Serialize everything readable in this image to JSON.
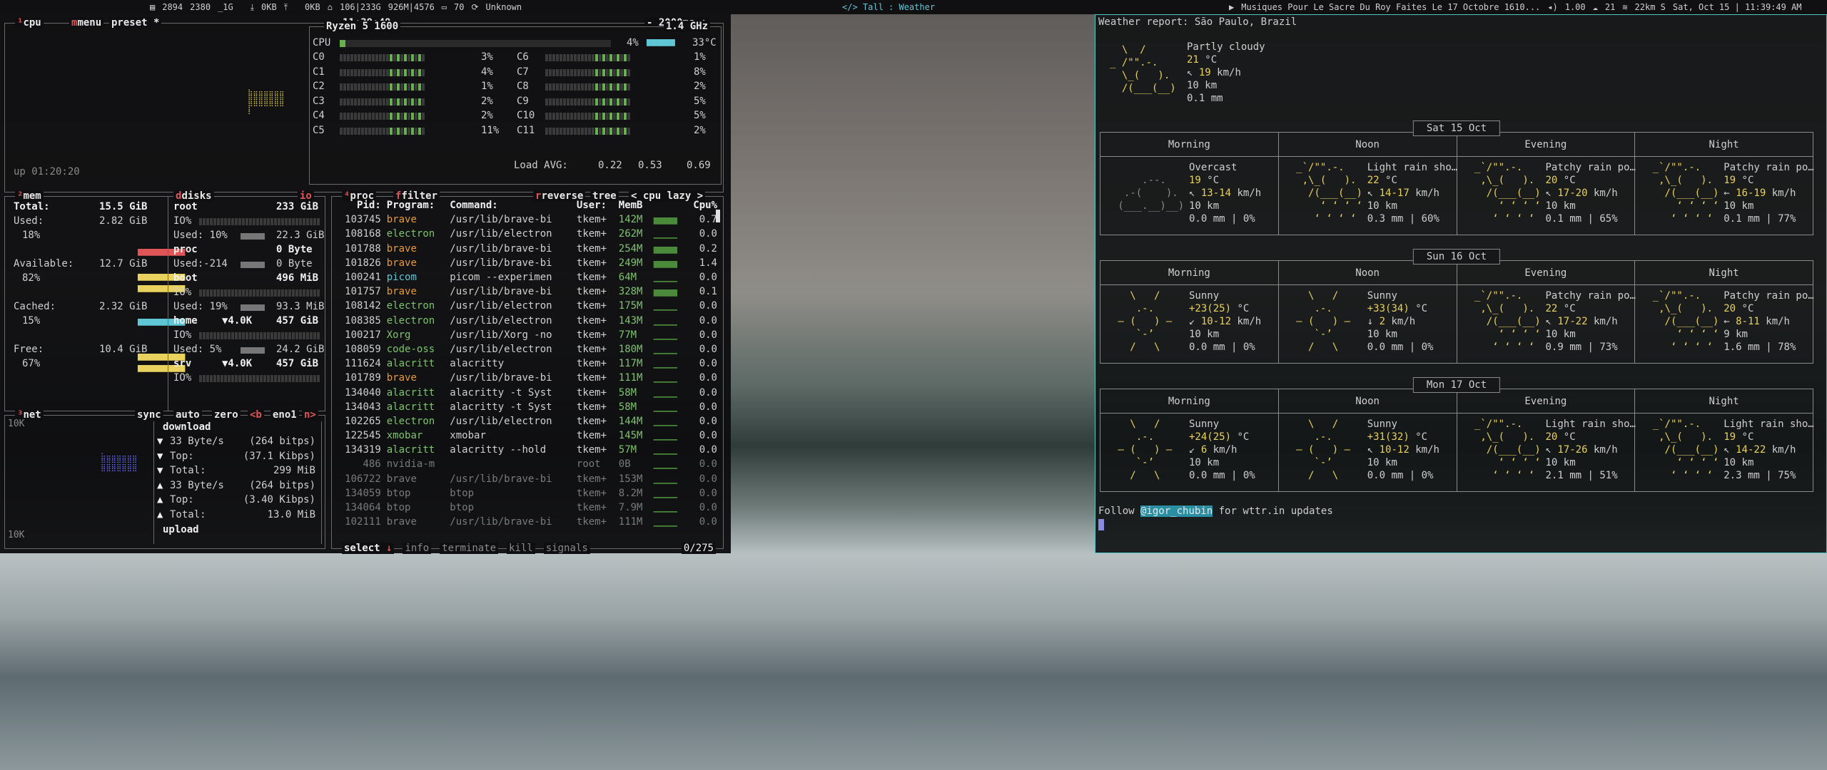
{
  "topbar": {
    "left": [
      "2894",
      "2380",
      "_1G",
      "0KB",
      "0KB",
      "106|233G",
      "926M|4576",
      "70",
      "Unknown"
    ],
    "center": "</>  Tall : Weather",
    "right": [
      "Musiques Pour Le Sacre Du Roy Faites Le 17 Octobre 1610...",
      "1.00",
      "21",
      "22km S",
      "Sat, Oct 15 | 11:39:49 AM"
    ]
  },
  "cpu": {
    "title": "cpu",
    "menu": "menu",
    "preset": "preset *",
    "time": "11:39:48",
    "interval": "- 2000ms +",
    "model": "Ryzen 5 1600",
    "freq": "1.4 GHz",
    "total_pct": "4%",
    "temp": "33°C",
    "uptime": "up 01:20:20",
    "cores": [
      {
        "n": "C0",
        "p": "3%",
        "n2": "C6",
        "p2": "1%"
      },
      {
        "n": "C1",
        "p": "4%",
        "n2": "C7",
        "p2": "8%"
      },
      {
        "n": "C2",
        "p": "1%",
        "n2": "C8",
        "p2": "2%"
      },
      {
        "n": "C3",
        "p": "2%",
        "n2": "C9",
        "p2": "5%"
      },
      {
        "n": "C4",
        "p": "2%",
        "n2": "C10",
        "p2": "5%"
      },
      {
        "n": "C5",
        "p": "11%",
        "n2": "C11",
        "p2": "2%"
      }
    ],
    "load_label": "Load AVG:",
    "load": [
      "0.22",
      "0.53",
      "0.69"
    ]
  },
  "mem": {
    "title": "mem",
    "total_label": "Total:",
    "total": "15.5 GiB",
    "used_label": "Used:",
    "used": "2.82 GiB",
    "used_pct": "18%",
    "avail_label": "Available:",
    "avail": "12.7 GiB",
    "avail_pct": "82%",
    "cached_label": "Cached:",
    "cached": "2.32 GiB",
    "cached_pct": "15%",
    "free_label": "Free:",
    "free": "10.4 GiB",
    "free_pct": "67%"
  },
  "disks": {
    "title": "disks",
    "io": "io",
    "items": [
      {
        "name": "root",
        "size": "233 GiB",
        "io": "IO%",
        "used": "Used: 10%",
        "uval": "22.3 GiB"
      },
      {
        "name": "proc",
        "size": "0 Byte",
        "io": "",
        "used": "Used:-214",
        "uval": "0 Byte"
      },
      {
        "name": "boot",
        "size": "496 MiB",
        "io": "IO%",
        "used": "Used: 19%",
        "uval": "93.3 MiB"
      },
      {
        "name": "home",
        "size": "457 GiB",
        "io": "IO%",
        "used": "Used:  5%",
        "uval": "24.2 GiB",
        "rate": "▼4.0K"
      },
      {
        "name": "srv",
        "size": "457 GiB",
        "io": "IO%",
        "used": "",
        "uval": "",
        "rate": "▼4.0K"
      }
    ]
  },
  "net": {
    "title": "net",
    "sync": "sync",
    "auto": "auto",
    "zero": "zero",
    "b": "<b",
    "iface": "eno1",
    "n": "n>",
    "scale_top": "10K",
    "scale_bot": "10K",
    "download": "download",
    "upload": "upload",
    "rows": [
      {
        "a": "▼",
        "k": "33 Byte/s",
        "v": "(264 bitps)"
      },
      {
        "a": "▼",
        "k": "Top:",
        "v": "(37.1 Kibps)"
      },
      {
        "a": "▼",
        "k": "Total:",
        "v": "299 MiB"
      },
      {
        "a": "▲",
        "k": "33 Byte/s",
        "v": "(264 bitps)"
      },
      {
        "a": "▲",
        "k": "Top:",
        "v": "(3.40 Kibps)"
      },
      {
        "a": "▲",
        "k": "Total:",
        "v": "13.0 MiB"
      }
    ]
  },
  "proc": {
    "title": "proc",
    "filter": "filter",
    "reverse": "reverse",
    "tree": "tree",
    "sort": "< cpu lazy >",
    "headers": [
      "Pid:",
      "Program:",
      "Command:",
      "User:",
      "MemB",
      "Cpu%"
    ],
    "rows": [
      [
        "103745",
        "brave",
        "/usr/lib/brave-bi",
        "tkem+",
        "142M",
        "0.7"
      ],
      [
        "108168",
        "electron",
        "/usr/lib/electron",
        "tkem+",
        "262M",
        "0.0"
      ],
      [
        "101788",
        "brave",
        "/usr/lib/brave-bi",
        "tkem+",
        "254M",
        "0.2"
      ],
      [
        "101826",
        "brave",
        "/usr/lib/brave-bi",
        "tkem+",
        "249M",
        "1.4"
      ],
      [
        "100241",
        "picom",
        "picom --experimen",
        "tkem+",
        "64M",
        "0.0"
      ],
      [
        "101757",
        "brave",
        "/usr/lib/brave-bi",
        "tkem+",
        "328M",
        "0.1"
      ],
      [
        "108142",
        "electron",
        "/usr/lib/electron",
        "tkem+",
        "175M",
        "0.0"
      ],
      [
        "108385",
        "electron",
        "/usr/lib/electron",
        "tkem+",
        "143M",
        "0.0"
      ],
      [
        "100217",
        "Xorg",
        "/usr/lib/Xorg -no",
        "tkem+",
        "77M",
        "0.0"
      ],
      [
        "108059",
        "code-oss",
        "/usr/lib/electron",
        "tkem+",
        "180M",
        "0.0"
      ],
      [
        "111624",
        "alacritt",
        "alacritty",
        "tkem+",
        "117M",
        "0.0"
      ],
      [
        "101789",
        "brave",
        "/usr/lib/brave-bi",
        "tkem+",
        "111M",
        "0.0"
      ],
      [
        "134040",
        "alacritt",
        "alacritty -t Syst",
        "tkem+",
        "58M",
        "0.0"
      ],
      [
        "134043",
        "alacritt",
        "alacritty -t Syst",
        "tkem+",
        "58M",
        "0.0"
      ],
      [
        "102265",
        "electron",
        "/usr/lib/electron",
        "tkem+",
        "144M",
        "0.0"
      ],
      [
        "122545",
        "xmobar",
        "xmobar",
        "tkem+",
        "145M",
        "0.0"
      ],
      [
        "134319",
        "alacritt",
        "alacritty --hold",
        "tkem+",
        "57M",
        "0.0"
      ],
      [
        "486",
        "nvidia-m",
        "",
        "root",
        "0B",
        "0.0"
      ],
      [
        "106722",
        "brave",
        "/usr/lib/brave-bi",
        "tkem+",
        "153M",
        "0.0"
      ],
      [
        "134059",
        "btop",
        "btop",
        "tkem+",
        "8.2M",
        "0.0"
      ],
      [
        "134064",
        "btop",
        "btop",
        "tkem+",
        "7.9M",
        "0.0"
      ],
      [
        "102111",
        "brave",
        "/usr/lib/brave-bi",
        "tkem+",
        "111M",
        "0.0"
      ]
    ],
    "footer": {
      "select": "select",
      "info": "info",
      "terminate": "terminate",
      "kill": "kill",
      "signals": "signals",
      "count": "0/275"
    }
  },
  "weather": {
    "header": "Weather report: São Paulo, Brazil",
    "now": {
      "cond": "Partly cloudy",
      "temp": "21",
      "tunit": " °C",
      "wind_dir": "↖",
      "wind": "19",
      "wunit": " km/h",
      "vis": "10 km",
      "precip": "0.1 mm"
    },
    "parts": [
      "Morning",
      "Noon",
      "Evening",
      "Night"
    ],
    "days": [
      {
        "label": "Sat 15 Oct",
        "slots": [
          {
            "cond": "Overcast",
            "t": "19",
            "wd": "↖",
            "w": "13-14",
            "vis": "10 km",
            "pr": "0.0 mm | 0%"
          },
          {
            "cond": "Light rain sho…",
            "t": "22",
            "wd": "↖",
            "w": "14-17",
            "vis": "10 km",
            "pr": "0.3 mm | 60%"
          },
          {
            "cond": "Patchy rain po…",
            "t": "20",
            "wd": "↖",
            "w": "17-20",
            "vis": "10 km",
            "pr": "0.1 mm | 65%"
          },
          {
            "cond": "Patchy rain po…",
            "t": "19",
            "wd": "←",
            "w": "16-19",
            "vis": "10 km",
            "pr": "0.1 mm | 77%"
          }
        ]
      },
      {
        "label": "Sun 16 Oct",
        "slots": [
          {
            "cond": "Sunny",
            "t": "+23(25)",
            "wd": "↙",
            "w": "10-12",
            "vis": "10 km",
            "pr": "0.0 mm | 0%"
          },
          {
            "cond": "Sunny",
            "t": "+33(34)",
            "wd": "↓",
            "w": "2",
            "vis": "10 km",
            "pr": "0.0 mm | 0%"
          },
          {
            "cond": "Patchy rain po…",
            "t": "22",
            "wd": "↖",
            "w": "17-22",
            "vis": "10 km",
            "pr": "0.9 mm | 73%"
          },
          {
            "cond": "Patchy rain po…",
            "t": "20",
            "wd": "←",
            "w": "8-11",
            "vis": "9 km",
            "pr": "1.6 mm | 78%"
          }
        ]
      },
      {
        "label": "Mon 17 Oct",
        "slots": [
          {
            "cond": "Sunny",
            "t": "+24(25)",
            "wd": "↙",
            "w": "6",
            "vis": "10 km",
            "pr": "0.0 mm | 0%"
          },
          {
            "cond": "Sunny",
            "t": "+31(32)",
            "wd": "↖",
            "w": "10-12",
            "vis": "10 km",
            "pr": "0.0 mm | 0%"
          },
          {
            "cond": "Light rain sho…",
            "t": "20",
            "wd": "↖",
            "w": "17-26",
            "vis": "10 km",
            "pr": "2.1 mm | 51%"
          },
          {
            "cond": "Light rain sho…",
            "t": "19",
            "wd": "↖",
            "w": "14-22",
            "vis": "10 km",
            "pr": "2.3 mm | 75%"
          }
        ]
      }
    ],
    "follow_pre": "Follow ",
    "follow_handle": "@igor_chubin",
    "follow_post": " for wttr.in updates"
  }
}
